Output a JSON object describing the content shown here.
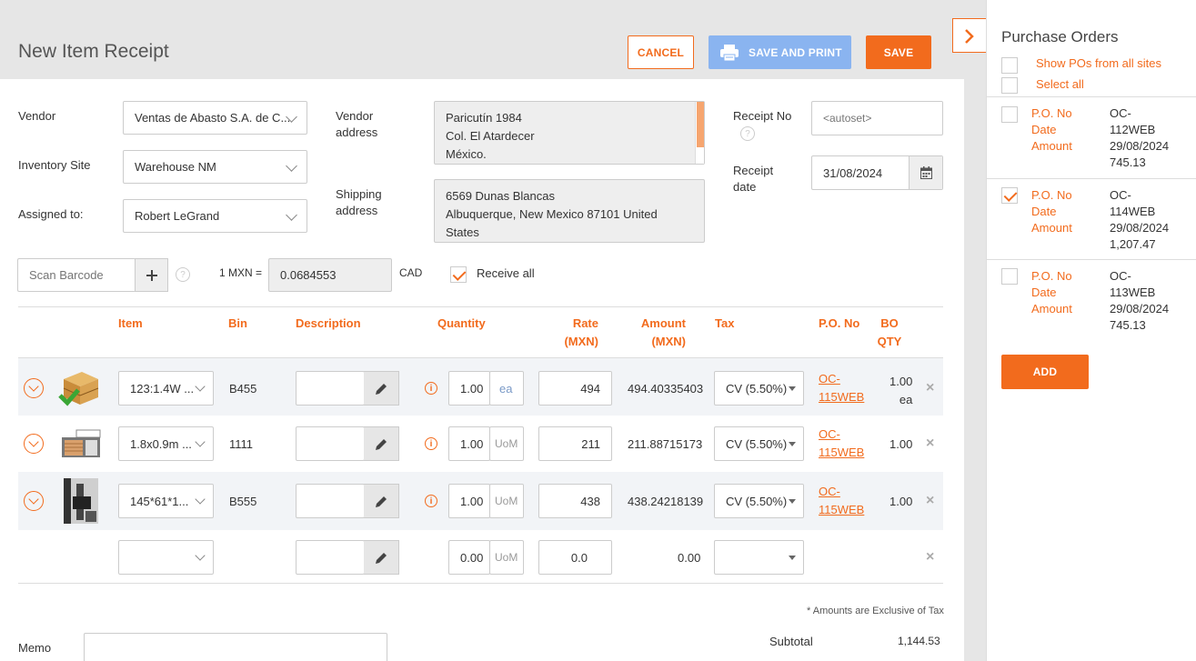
{
  "header": {
    "title": "New Item Receipt",
    "cancel_label": "CANCEL",
    "save_print_label": "SAVE AND PRINT",
    "save_label": "SAVE"
  },
  "form": {
    "vendor_label": "Vendor",
    "vendor_value": "Ventas de Abasto S.A. de C...",
    "site_label": "Inventory Site",
    "site_value": "Warehouse NM",
    "assigned_label": "Assigned to:",
    "assigned_value": "Robert LeGrand",
    "vendor_address_label_1": "Vendor",
    "vendor_address_label_2": "address",
    "vendor_address": [
      "Paricutín 1984",
      "Col. El Atardecer",
      "México."
    ],
    "shipping_label_1": "Shipping",
    "shipping_label_2": "address",
    "shipping_address": [
      "6569 Dunas Blancas",
      "Albuquerque, New Mexico 87101 United States"
    ],
    "receipt_no_label": "Receipt No",
    "receipt_no_placeholder": "<autoset>",
    "receipt_date_label_1": "Receipt",
    "receipt_date_label_2": "date",
    "receipt_date_value": "31/08/2024",
    "barcode_placeholder": "Scan Barcode",
    "rate_label": "1 MXN =",
    "rate_value": "0.0684553",
    "currency": "CAD",
    "receive_all_label": "Receive all"
  },
  "table": {
    "headers": {
      "item": "Item",
      "bin": "Bin",
      "description": "Description",
      "quantity": "Quantity",
      "rate_1": "Rate",
      "rate_2": "(MXN)",
      "amount_1": "Amount",
      "amount_2": "(MXN)",
      "tax": "Tax",
      "po_no": "P.O. No",
      "bo_1": "BO",
      "bo_2": "QTY"
    },
    "rows": [
      {
        "item": "123:1.4W ...",
        "bin": "B455",
        "qty": "1.00",
        "uom": "ea",
        "rate": "494",
        "amount": "494.40335403",
        "tax": "CV (5.50%)",
        "po_1": "OC-",
        "po_2": "115WEB",
        "bo": "1.00",
        "bo_unit": "ea"
      },
      {
        "item": "1.8x0.9m ...",
        "bin": "1111",
        "qty": "1.00",
        "uom": "UoM",
        "rate": "211",
        "amount": "211.88715173",
        "tax": "CV (5.50%)",
        "po_1": "OC-",
        "po_2": "115WEB",
        "bo": "1.00"
      },
      {
        "item": "145*61*1...",
        "bin": "B555",
        "qty": "1.00",
        "uom": "UoM",
        "rate": "438",
        "amount": "438.24218139",
        "tax": "CV (5.50%)",
        "po_1": "OC-",
        "po_2": "115WEB",
        "bo": "1.00"
      },
      {
        "item": "",
        "bin": "",
        "qty": "0.00",
        "uom": "UoM",
        "rate": "0.0",
        "amount": "0.00",
        "tax": ""
      }
    ]
  },
  "footer": {
    "note": "* Amounts are Exclusive of Tax",
    "memo_label": "Memo",
    "subtotal_label": "Subtotal",
    "subtotal_value": "1,144.53"
  },
  "panel": {
    "title": "Purchase Orders",
    "show_all_label": "Show POs from all sites",
    "select_all_label": "Select all",
    "po_label": "P.O. No",
    "date_label": "Date",
    "amount_label": "Amount",
    "orders": [
      {
        "po_1": "OC-",
        "po_2": "112WEB",
        "date": "29/08/2024",
        "amount": "745.13",
        "checked": false
      },
      {
        "po_1": "OC-",
        "po_2": "114WEB",
        "date": "29/08/2024",
        "amount": "1,207.47",
        "checked": true
      },
      {
        "po_1": "OC-",
        "po_2": "113WEB",
        "date": "29/08/2024",
        "amount": "745.13",
        "checked": false
      }
    ],
    "add_label": "ADD"
  },
  "colors": {
    "accent": "#f26b1d",
    "save_print": "#8ab4f0",
    "row_bg": "#f2f4f7"
  },
  "icons": [
    "chevron-right-icon",
    "printer-icon",
    "calendar-icon",
    "plus-icon",
    "help-icon",
    "pencil-icon",
    "info-icon",
    "close-icon",
    "chevron-down-icon"
  ]
}
